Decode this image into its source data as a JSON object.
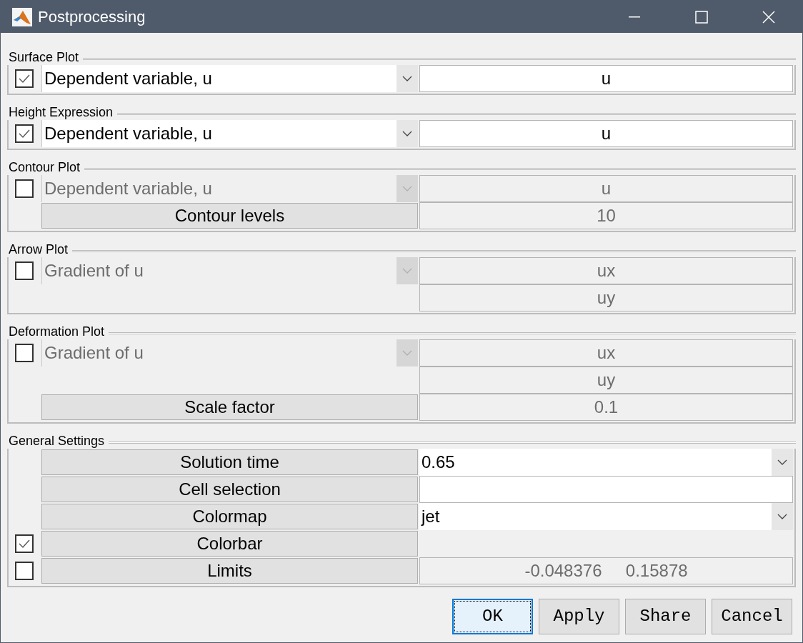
{
  "window": {
    "title": "Postprocessing"
  },
  "sections": [
    {
      "title": "Surface Plot",
      "rows": [
        {
          "checkbox": {
            "checked": true
          },
          "left": {
            "kind": "dropdown",
            "text": "Dependent variable, u",
            "disabled": false
          },
          "right": {
            "kind": "field",
            "value": "u",
            "disabled": false
          }
        }
      ]
    },
    {
      "title": "Height Expression",
      "rows": [
        {
          "checkbox": {
            "checked": true
          },
          "left": {
            "kind": "dropdown",
            "text": "Dependent variable, u",
            "disabled": false
          },
          "right": {
            "kind": "field",
            "value": "u",
            "disabled": false
          }
        }
      ]
    },
    {
      "title": "Contour Plot",
      "rows": [
        {
          "checkbox": {
            "checked": false
          },
          "left": {
            "kind": "dropdown",
            "text": "Dependent variable, u",
            "disabled": true
          },
          "right": {
            "kind": "field",
            "value": "u",
            "disabled": true
          }
        },
        {
          "left": {
            "kind": "button",
            "text": "Contour levels"
          },
          "right": {
            "kind": "field",
            "value": "10",
            "disabled": true
          }
        }
      ]
    },
    {
      "title": "Arrow Plot",
      "rows": [
        {
          "checkbox": {
            "checked": false
          },
          "left": {
            "kind": "dropdown",
            "text": "Gradient of u",
            "disabled": true
          },
          "right": {
            "kind": "field",
            "value": "ux",
            "disabled": true
          }
        },
        {
          "right": {
            "kind": "field",
            "value": "uy",
            "disabled": true
          }
        }
      ]
    },
    {
      "title": "Deformation Plot",
      "rows": [
        {
          "checkbox": {
            "checked": false
          },
          "left": {
            "kind": "dropdown",
            "text": "Gradient of u",
            "disabled": true
          },
          "right": {
            "kind": "field",
            "value": "ux",
            "disabled": true
          }
        },
        {
          "right": {
            "kind": "field",
            "value": "uy",
            "disabled": true
          }
        },
        {
          "left": {
            "kind": "button",
            "text": "Scale factor"
          },
          "right": {
            "kind": "field",
            "value": "0.1",
            "disabled": true
          }
        }
      ]
    },
    {
      "title": "General Settings",
      "rows": [
        {
          "left": {
            "kind": "button",
            "text": "Solution time"
          },
          "right": {
            "kind": "dropdown",
            "value": "0.65"
          }
        },
        {
          "left": {
            "kind": "button",
            "text": "Cell selection"
          },
          "right": {
            "kind": "field",
            "disabled": false
          }
        },
        {
          "left": {
            "kind": "button",
            "text": "Colormap"
          },
          "right": {
            "kind": "dropdown",
            "value": "jet"
          }
        },
        {
          "checkbox": {
            "checked": true
          },
          "left": {
            "kind": "button",
            "text": "Colorbar"
          }
        },
        {
          "checkbox": {
            "checked": false
          },
          "left": {
            "kind": "button",
            "text": "Limits"
          },
          "right": {
            "kind": "field",
            "value": "-0.048376     0.15878",
            "disabled": true
          }
        }
      ]
    }
  ],
  "buttons": [
    {
      "label": "OK",
      "default": true
    },
    {
      "label": "Apply",
      "default": false
    },
    {
      "label": "Share",
      "default": false
    },
    {
      "label": "Cancel",
      "default": false
    }
  ]
}
